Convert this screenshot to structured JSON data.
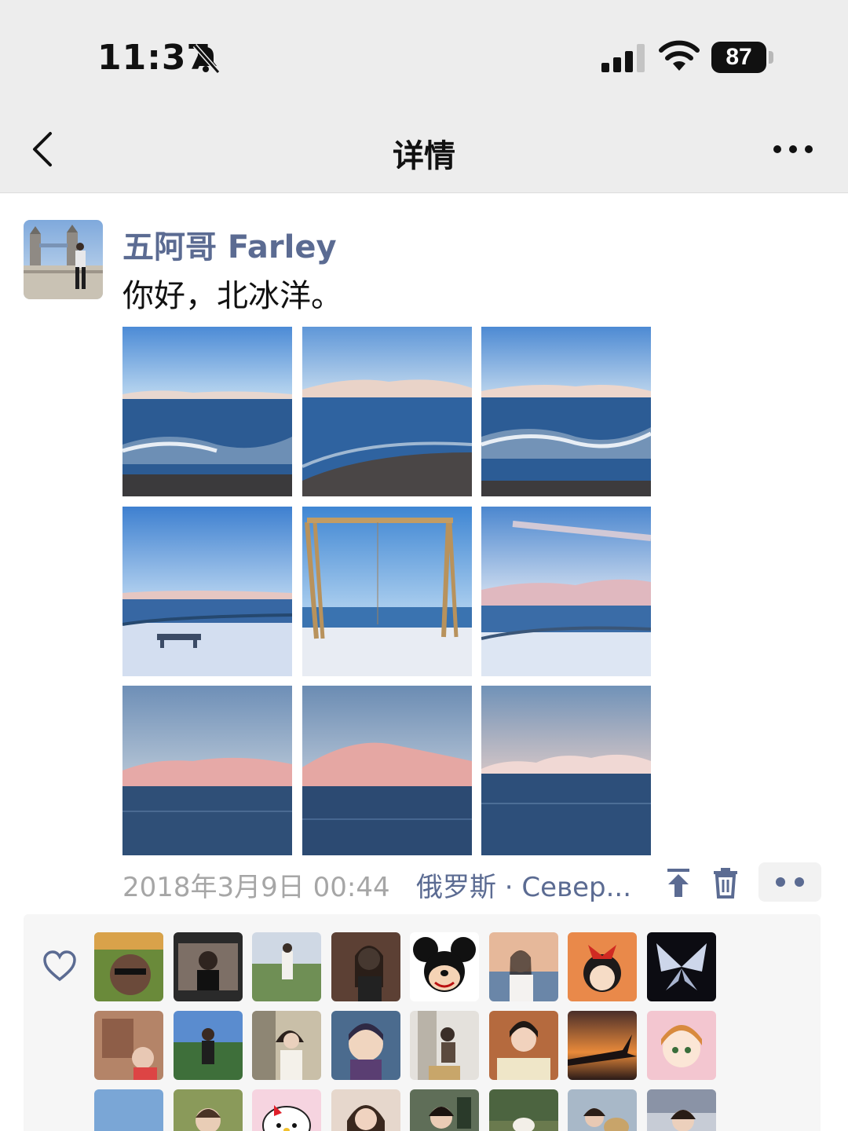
{
  "status_bar": {
    "time": "11:37",
    "battery": "87",
    "icons": [
      "bell-muted-icon",
      "signal-icon",
      "wifi-icon",
      "battery-icon"
    ]
  },
  "nav": {
    "back_icon": "chevron-left-icon",
    "title": "详情",
    "more_icon": "more-dots-icon"
  },
  "post": {
    "author": "五阿哥 Farley",
    "text": "你好，北冰洋。",
    "photo_count": 9,
    "timestamp": "2018年3月9日 00:44",
    "location": "俄罗斯 · Север...",
    "actions": [
      "pin-top-icon",
      "trash-icon",
      "comment-dots-icon"
    ]
  },
  "likes": {
    "icon": "heart-icon",
    "visible_avatar_count": 24
  },
  "colors": {
    "name_link": "#5b6b92",
    "timestamp": "#a6a6a6",
    "bar_bg": "#ededed",
    "likes_bg": "#f6f6f6"
  }
}
